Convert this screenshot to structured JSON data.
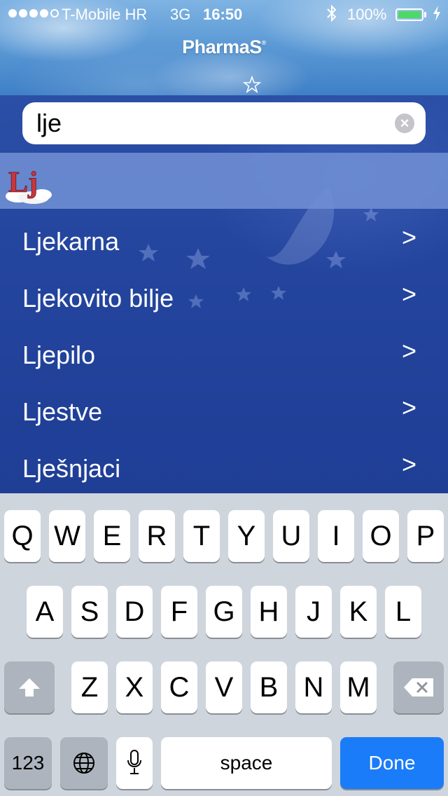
{
  "status_bar": {
    "carrier": "T-Mobile HR",
    "network": "3G",
    "time": "16:50",
    "battery": "100%",
    "battery_level": 1.0,
    "bluetooth_icon": "bluetooth-icon",
    "charging_icon": "charging-bolt-icon"
  },
  "header": {
    "title": "PharmaS",
    "registered_mark": "®"
  },
  "search": {
    "value": "lje",
    "clear_icon": "clear-icon"
  },
  "section": {
    "letter": "Lj"
  },
  "results": [
    {
      "label": "Ljekarna",
      "chevron": ">"
    },
    {
      "label": "Ljekovito bilje",
      "chevron": ">"
    },
    {
      "label": "Ljepilo",
      "chevron": ">"
    },
    {
      "label": "Ljestve",
      "chevron": ">"
    },
    {
      "label": "Lješnjaci",
      "chevron": ">"
    }
  ],
  "keyboard": {
    "row1": [
      "Q",
      "W",
      "E",
      "R",
      "T",
      "Y",
      "U",
      "I",
      "O",
      "P"
    ],
    "row2": [
      "A",
      "S",
      "D",
      "F",
      "G",
      "H",
      "J",
      "K",
      "L"
    ],
    "row3": [
      "Z",
      "X",
      "C",
      "V",
      "B",
      "N",
      "M"
    ],
    "numbers_label": "123",
    "space_label": "space",
    "done_label": "Done",
    "shift_icon": "shift-icon",
    "delete_icon": "delete-icon",
    "globe_icon": "globe-icon",
    "mic_icon": "microphone-icon"
  },
  "colors": {
    "accent": "#1a7cf8",
    "list_background": "#24459e",
    "section_header": "#708ed4",
    "battery_green": "#4cd964"
  }
}
